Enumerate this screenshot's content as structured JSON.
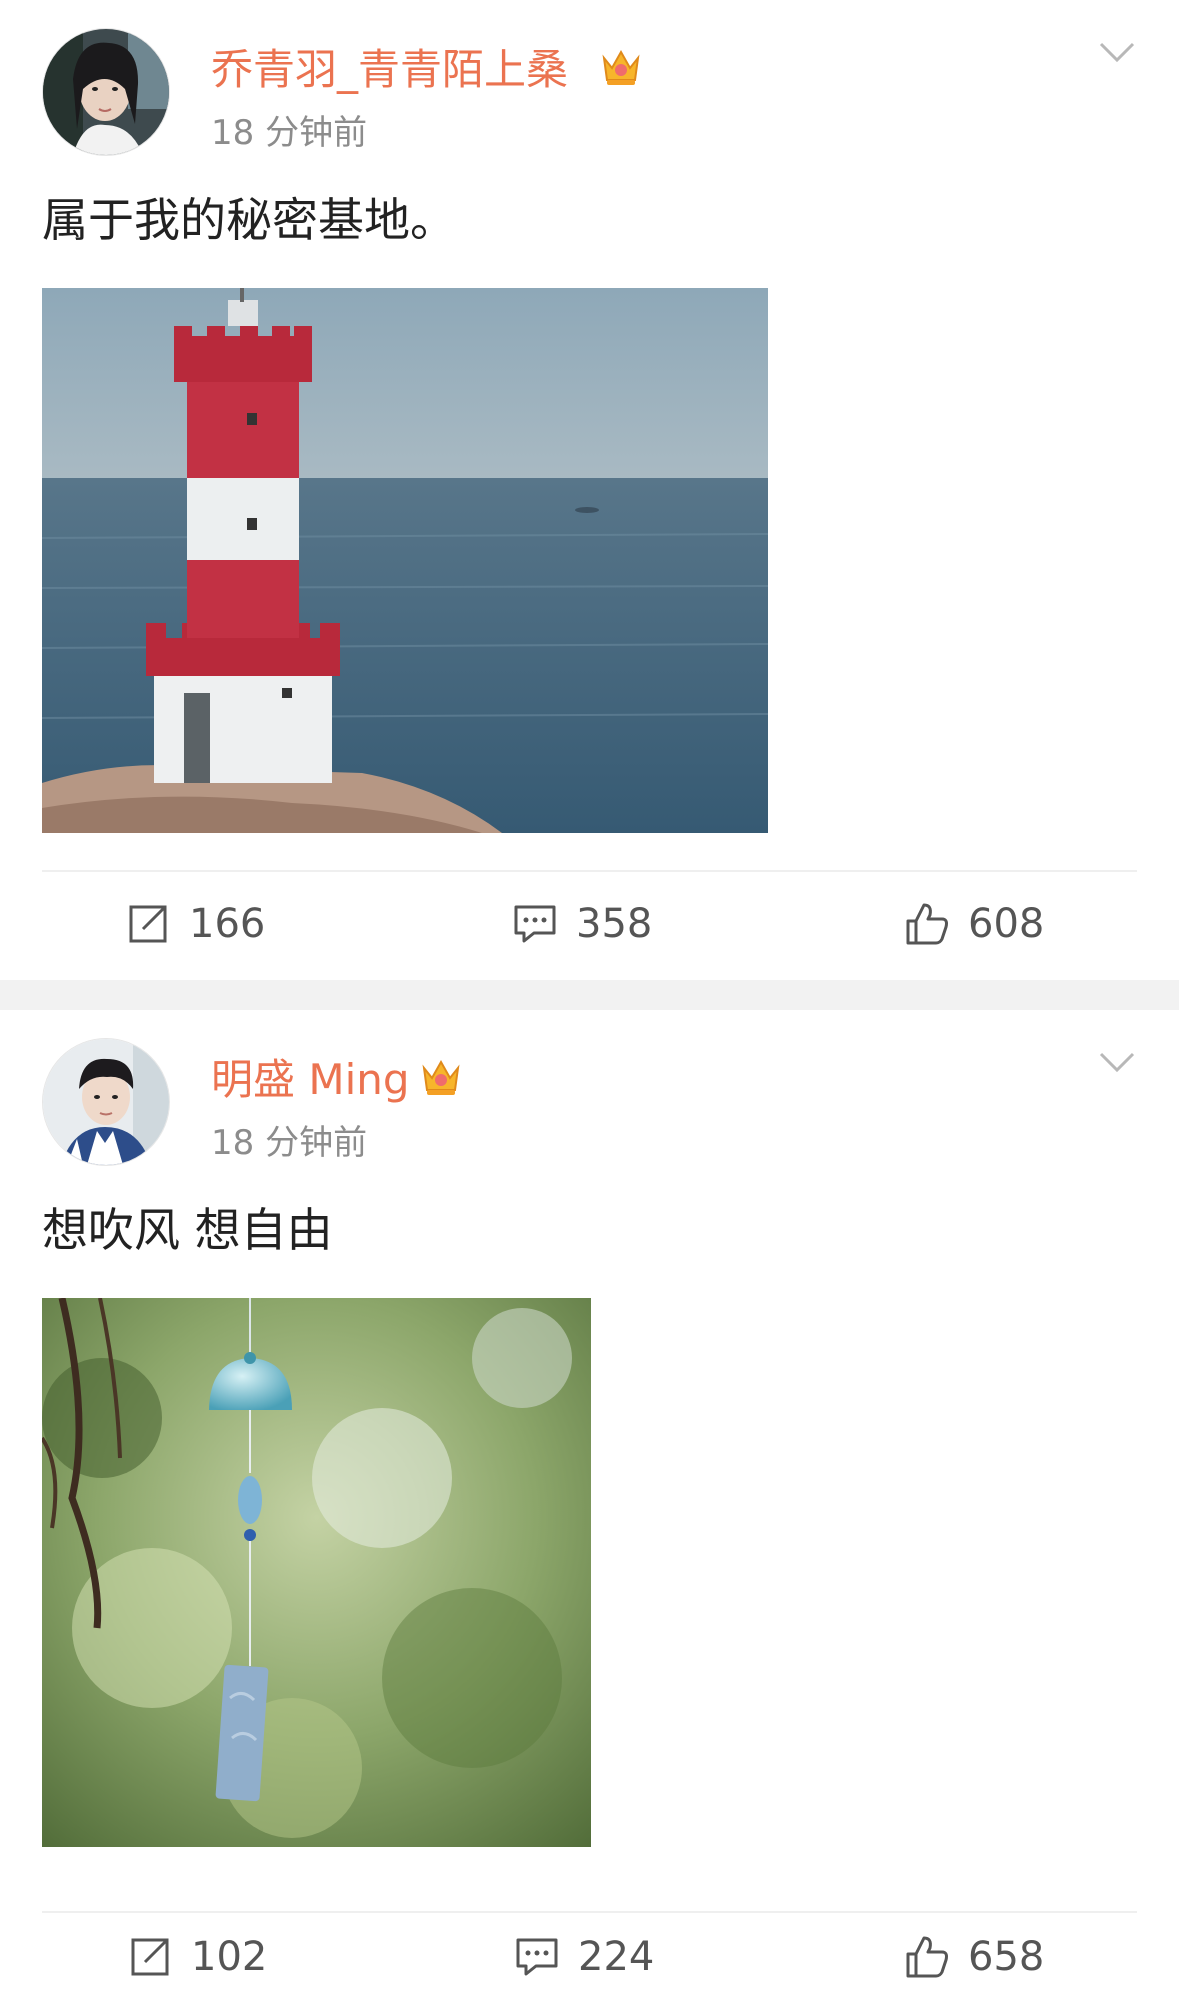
{
  "feed": {
    "posts": [
      {
        "username": "乔青羽_青青陌上桑",
        "time": "18 分钟前",
        "text": "属于我的秘密基地。",
        "image_subject": "lighthouse",
        "repost_count": "166",
        "comment_count": "358",
        "like_count": "608"
      },
      {
        "username": "明盛 Ming",
        "time": "18 分钟前",
        "text": "想吹风 想自由",
        "image_subject": "wind-chime",
        "repost_count": "102",
        "comment_count": "224",
        "like_count": "658"
      }
    ]
  },
  "icons": {
    "verified": "crown-icon",
    "menu": "chevron-down-icon",
    "repost": "repost-icon",
    "comment": "comment-icon",
    "like": "thumbs-up-icon"
  },
  "colors": {
    "username": "#eb7350",
    "time": "#8c8c8c",
    "text": "#222222",
    "action": "#555555",
    "separator": "#f2f2f2"
  }
}
